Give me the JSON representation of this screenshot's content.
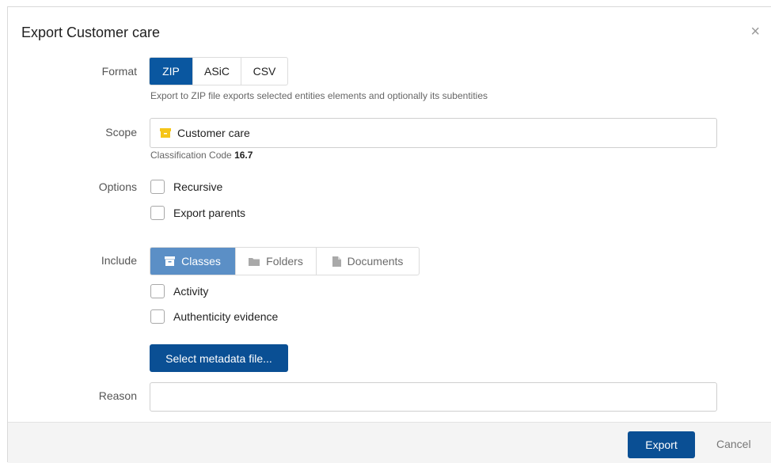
{
  "dialog": {
    "title": "Export Customer care",
    "close_glyph": "×"
  },
  "format": {
    "label": "Format",
    "options": [
      "ZIP",
      "ASiC",
      "CSV"
    ],
    "selected": "ZIP",
    "hint": "Export to ZIP file exports selected entities elements and optionally its subentities"
  },
  "scope": {
    "label": "Scope",
    "value": "Customer care",
    "icon": "box-icon",
    "icon_color": "#f5c518",
    "code_label": "Classification Code",
    "code_value": "16.7"
  },
  "options": {
    "label": "Options",
    "items": [
      {
        "label": "Recursive",
        "checked": false
      },
      {
        "label": "Export parents",
        "checked": false
      }
    ]
  },
  "include": {
    "label": "Include",
    "tabs": [
      {
        "label": "Classes",
        "icon": "class-box-icon",
        "active": true
      },
      {
        "label": "Folders",
        "icon": "folder-icon",
        "active": false
      },
      {
        "label": "Documents",
        "icon": "document-icon",
        "active": false
      }
    ],
    "items": [
      {
        "label": "Activity",
        "checked": false
      },
      {
        "label": "Authenticity evidence",
        "checked": false
      }
    ],
    "metadata_button": "Select metadata file..."
  },
  "reason": {
    "label": "Reason",
    "value": "",
    "placeholder": ""
  },
  "footer": {
    "export_label": "Export",
    "cancel_label": "Cancel"
  },
  "colors": {
    "primary": "#0a4f94",
    "active_segment": "#0a57a0",
    "include_active": "#5b8fc6",
    "footer_bg": "#f4f4f4"
  }
}
